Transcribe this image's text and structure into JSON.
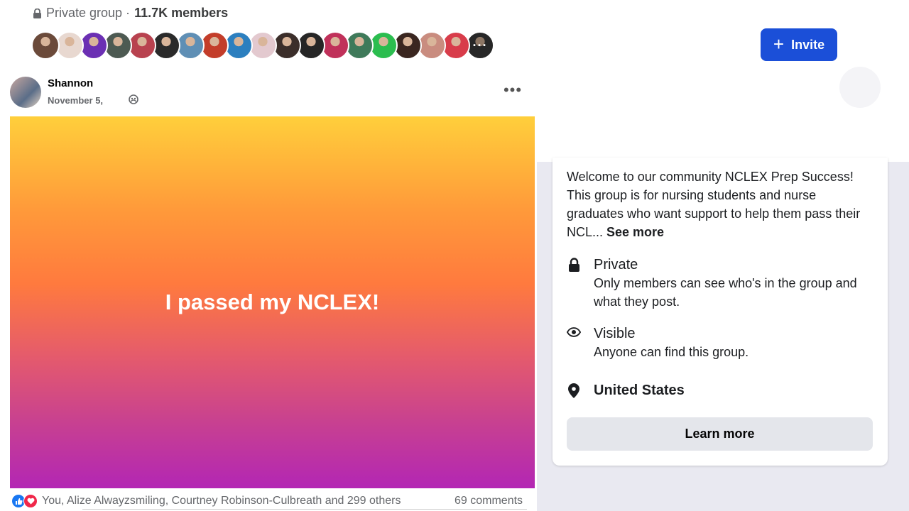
{
  "group": {
    "privacy_label": "Private group · ",
    "members": "11.7K members"
  },
  "member_avatars": [
    {
      "color": "#6b4a3a"
    },
    {
      "color": "#e8d8d0"
    },
    {
      "color": "#6b2fb3"
    },
    {
      "color": "#4d5a52"
    },
    {
      "color": "#b8424f"
    },
    {
      "color": "#2a2a2a"
    },
    {
      "color": "#5f8fb5"
    },
    {
      "color": "#c33d2a"
    },
    {
      "color": "#2c7fbf"
    },
    {
      "color": "#e3c9cf"
    },
    {
      "color": "#3b2e2a"
    },
    {
      "color": "#262626"
    },
    {
      "color": "#c0315a"
    },
    {
      "color": "#3f7a5a"
    },
    {
      "color": "#2bbd4f"
    },
    {
      "color": "#3a2620"
    },
    {
      "color": "#c98c7f"
    },
    {
      "color": "#d83c4a"
    },
    {
      "color": "#3d3d3d"
    }
  ],
  "more_members_label": "···",
  "invite": {
    "label": "Invite",
    "icon": "plus-icon"
  },
  "post": {
    "author": "Shannon",
    "date": "November 5,",
    "audience_icon": "group-audience-icon",
    "text": "I passed my NCLEX!",
    "reactions_text": "You, Alize Alwayzsmiling, Courtney Robinson-Culbreath and 299 others",
    "comments": "69 comments",
    "more_label": "•••"
  },
  "about": {
    "description": "Welcome to our community NCLEX Prep Success! This group is for nursing students and nurse graduates who want support to help them pass their NCL... ",
    "see_more": "See more",
    "private_title": "Private",
    "private_sub": "Only members can see who's in the group and what they post.",
    "visible_title": "Visible",
    "visible_sub": "Anyone can find this group.",
    "location": "United States",
    "learn_more": "Learn more"
  },
  "colors": {
    "invite_bg": "#1b4fd8",
    "like": "#1877f2",
    "love": "#f0284a",
    "right_panel_bg": "#e9e9f1"
  }
}
